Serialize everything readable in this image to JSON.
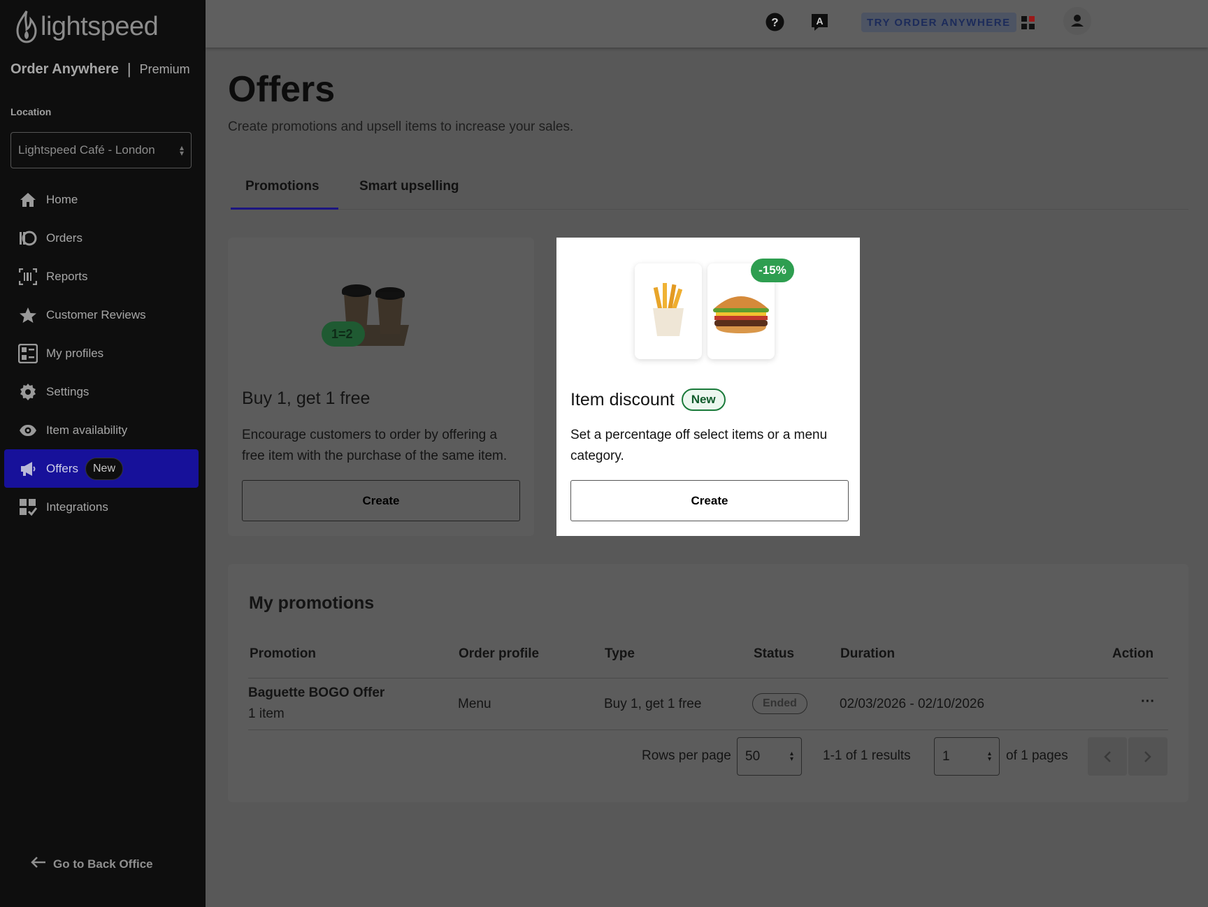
{
  "brand": {
    "logo_text": "lightspeed",
    "product": "Order Anywhere",
    "separator": "|",
    "tier": "Premium"
  },
  "location": {
    "label": "Location",
    "value": "Lightspeed Café - London"
  },
  "nav": {
    "items": [
      {
        "label": "Home",
        "icon": "home-icon"
      },
      {
        "label": "Orders",
        "icon": "orders-icon"
      },
      {
        "label": "Reports",
        "icon": "reports-icon"
      },
      {
        "label": "Customer Reviews",
        "icon": "star-icon"
      },
      {
        "label": "My profiles",
        "icon": "profiles-icon"
      },
      {
        "label": "Settings",
        "icon": "gear-icon"
      },
      {
        "label": "Item availability",
        "icon": "eye-icon"
      },
      {
        "label": "Offers",
        "icon": "megaphone-icon",
        "badge": "New",
        "active": true
      },
      {
        "label": "Integrations",
        "icon": "integrations-icon"
      }
    ],
    "back_link": "Go to Back Office"
  },
  "topbar": {
    "try_button": "TRY ORDER ANYWHERE",
    "help_icon": "help-icon",
    "translate_icon": "translate-icon",
    "apps_icon": "apps-icon",
    "user_icon": "user-icon"
  },
  "page": {
    "title": "Offers",
    "subtitle": "Create promotions and upsell items to increase your sales.",
    "tabs": [
      {
        "label": "Promotions",
        "active": true
      },
      {
        "label": "Smart upselling",
        "active": false
      }
    ]
  },
  "cards": [
    {
      "title": "Buy 1, get 1 free",
      "description": "Encourage customers to order by offering a free item with the purchase of the same item.",
      "button": "Create",
      "image_badge": "1=2"
    },
    {
      "title": "Item discount",
      "badge": "New",
      "description": "Set a percentage off select items or a menu category.",
      "button": "Create",
      "image_badge": "-15%"
    }
  ],
  "promotions": {
    "title": "My promotions",
    "columns": [
      "Promotion",
      "Order profile",
      "Type",
      "Status",
      "Duration",
      "Action"
    ],
    "rows": [
      {
        "name": "Baguette BOGO Offer",
        "items": "1 item",
        "order_profile": "Menu",
        "type": "Buy 1, get 1 free",
        "status": "Ended",
        "duration": "02/03/2026 - 02/10/2026",
        "action": "···"
      }
    ],
    "pagination": {
      "rows_label": "Rows per page",
      "rows_value": "50",
      "results": "1-1 of 1 results",
      "page_value": "1",
      "pages_label": "of 1 pages"
    }
  },
  "colors": {
    "sidebar": "#0e0e0e",
    "active_nav": "#17119a",
    "overlay_bg": "#585858",
    "highlight_card": "#ffffff",
    "discount_green": "#2e9e50"
  }
}
